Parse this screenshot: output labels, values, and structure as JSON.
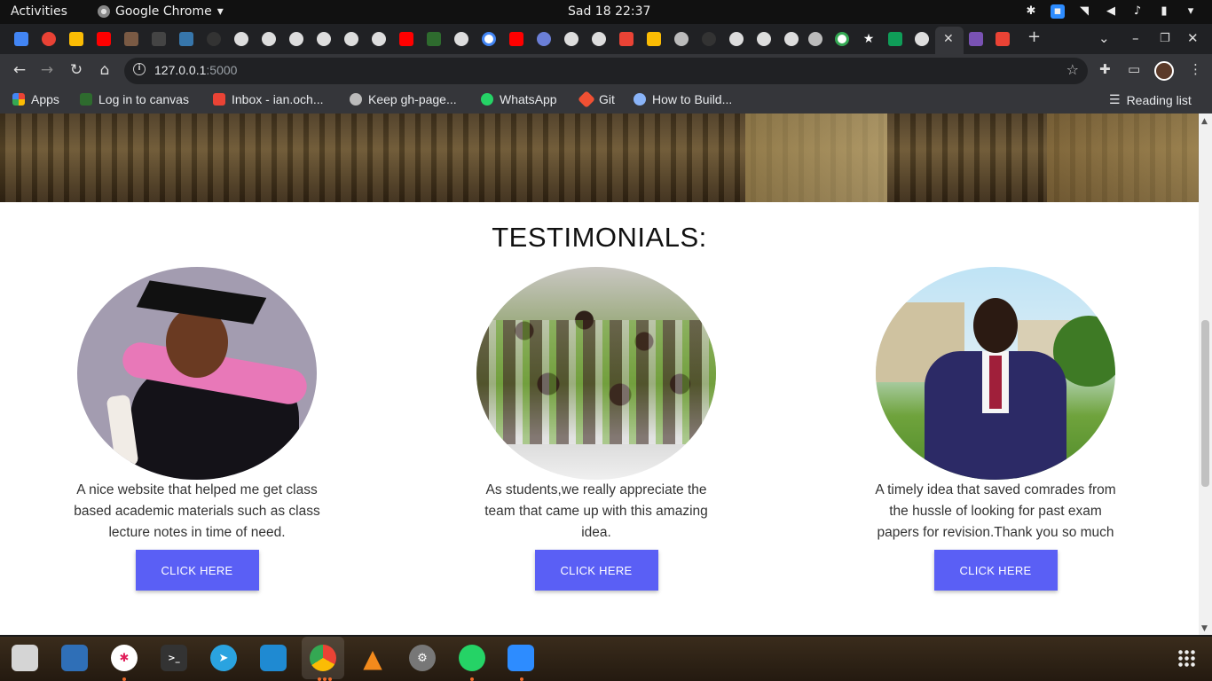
{
  "system_bar": {
    "activities": "Activities",
    "app_name": "Google Chrome",
    "clock": "Sad 18  22:37"
  },
  "browser": {
    "url_host": "127.0.0.1",
    "url_port": ":5000",
    "bookmarks": [
      {
        "label": "Apps",
        "icon": "apps-grid-icon",
        "color": "#e94235"
      },
      {
        "label": "Log in to canvas",
        "icon": "canvas-icon",
        "color": "#2e6b2e"
      },
      {
        "label": "Inbox - ian.och...",
        "icon": "gmail-icon",
        "color": "#ea4335"
      },
      {
        "label": "Keep gh-page...",
        "icon": "github-icon",
        "color": "#bbbbbb"
      },
      {
        "label": "WhatsApp",
        "icon": "whatsapp-icon",
        "color": "#25d366"
      },
      {
        "label": "Git",
        "icon": "git-icon",
        "color": "#f05033"
      },
      {
        "label": "How to Build...",
        "icon": "site-icon",
        "color": "#8ab4f8"
      }
    ],
    "reading_list": "Reading list"
  },
  "page": {
    "section_title": "TESTIMONIALS:",
    "testimonials": [
      {
        "text": "A nice website that helped me get class based academic materials such as class lecture notes in time of need.",
        "button": "CLICK HERE",
        "photo": "graduate-photo"
      },
      {
        "text": "As students,we really appreciate the team that came up with this amazing idea.",
        "button": "CLICK HERE",
        "photo": "students-crowd-photo"
      },
      {
        "text": "A timely idea that saved comrades from the hussle of looking for past exam papers for revision.Thank you so much",
        "button": "CLICK HERE",
        "photo": "man-in-suit-photo"
      }
    ]
  },
  "colors": {
    "button": "#5a5ff5",
    "chrome_dark": "#35363a"
  }
}
